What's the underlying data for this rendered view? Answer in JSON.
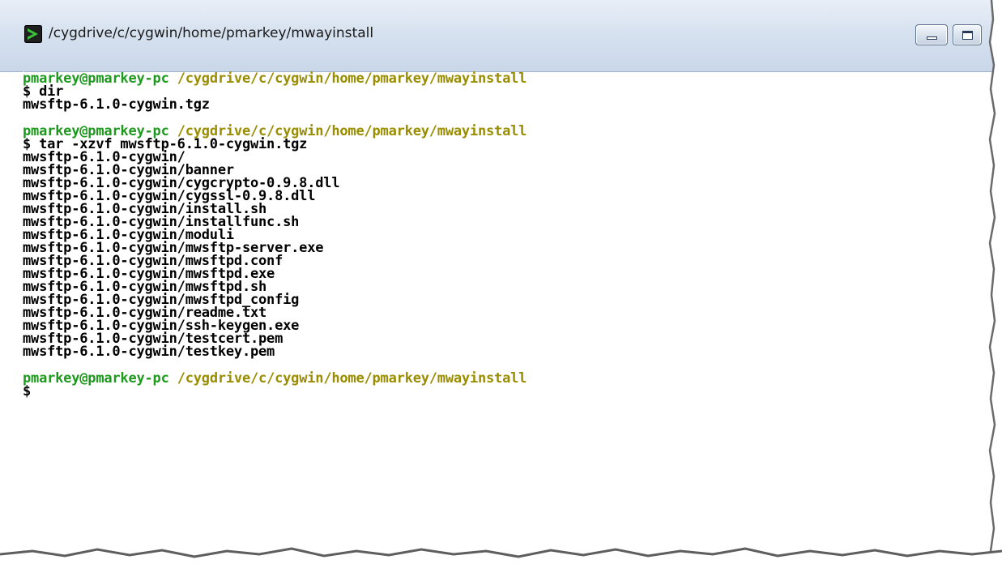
{
  "window": {
    "title": "/cygdrive/c/cygwin/home/pmarkey/mwayinstall",
    "app_icon": "cygwin-terminal-icon",
    "controls": {
      "minimize_icon": "minimize-icon",
      "maximize_icon": "maximize-icon"
    }
  },
  "terminal": {
    "colors": {
      "background": "#ffffff",
      "text": "#000000",
      "user_host": "#1d9a1d",
      "path": "#9a8d00"
    },
    "prompt_1": {
      "user_host": "pmarkey@pmarkey-pc",
      "path": "/cygdrive/c/cygwin/home/pmarkey/mwayinstall",
      "command": "$ dir"
    },
    "output_1": [
      "mwsftp-6.1.0-cygwin.tgz"
    ],
    "prompt_2": {
      "user_host": "pmarkey@pmarkey-pc",
      "path": "/cygdrive/c/cygwin/home/pmarkey/mwayinstall",
      "command": "$ tar -xzvf mwsftp-6.1.0-cygwin.tgz"
    },
    "output_2": [
      "mwsftp-6.1.0-cygwin/",
      "mwsftp-6.1.0-cygwin/banner",
      "mwsftp-6.1.0-cygwin/cygcrypto-0.9.8.dll",
      "mwsftp-6.1.0-cygwin/cygssl-0.9.8.dll",
      "mwsftp-6.1.0-cygwin/install.sh",
      "mwsftp-6.1.0-cygwin/installfunc.sh",
      "mwsftp-6.1.0-cygwin/moduli",
      "mwsftp-6.1.0-cygwin/mwsftp-server.exe",
      "mwsftp-6.1.0-cygwin/mwsftpd.conf",
      "mwsftp-6.1.0-cygwin/mwsftpd.exe",
      "mwsftp-6.1.0-cygwin/mwsftpd.sh",
      "mwsftp-6.1.0-cygwin/mwsftpd_config",
      "mwsftp-6.1.0-cygwin/readme.txt",
      "mwsftp-6.1.0-cygwin/ssh-keygen.exe",
      "mwsftp-6.1.0-cygwin/testcert.pem",
      "mwsftp-6.1.0-cygwin/testkey.pem"
    ],
    "prompt_3": {
      "user_host": "pmarkey@pmarkey-pc",
      "path": "/cygdrive/c/cygwin/home/pmarkey/mwayinstall",
      "command": "$"
    }
  }
}
